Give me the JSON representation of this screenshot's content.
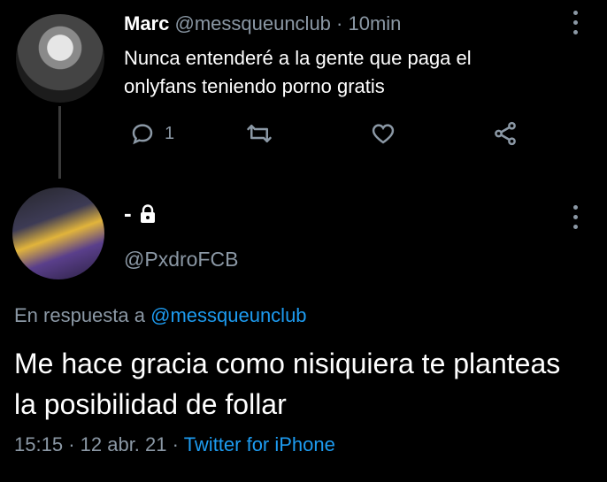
{
  "original_tweet": {
    "name": "Marc",
    "handle": "@messqueunclub",
    "separator": "·",
    "time": "10min",
    "text": "Nunca entenderé a la gente que paga el onlyfans teniendo porno gratis",
    "actions": {
      "reply_count": "1",
      "reply_icon": "reply-icon",
      "retweet_icon": "retweet-icon",
      "like_icon": "heart-icon",
      "share_icon": "share-icon"
    }
  },
  "reply_tweet": {
    "name": "-",
    "lock_icon": "lock-icon",
    "handle": "@PxdroFCB",
    "replying_prefix": "En respuesta a",
    "replying_to": "@messqueunclub",
    "text": "Me hace gracia como nisiquiera te planteas la posibilidad de follar",
    "time": "15:15",
    "separator_1": "·",
    "date": "12 abr. 21",
    "separator_2": "·",
    "source": "Twitter for iPhone"
  },
  "colors": {
    "background": "#000000",
    "text": "#ffffff",
    "muted": "#8b98a5",
    "link": "#1d9bf0"
  }
}
